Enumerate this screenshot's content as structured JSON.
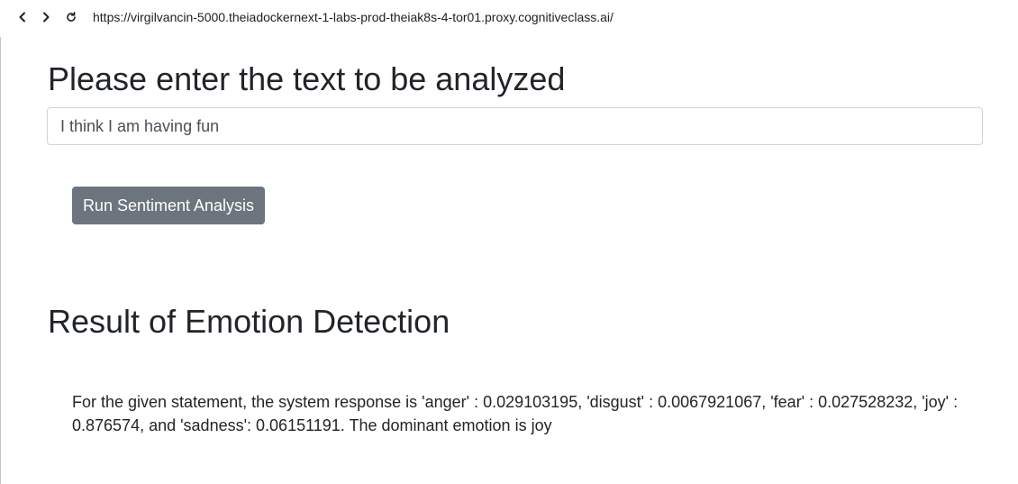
{
  "browser": {
    "back_icon": "chevron-left-icon",
    "forward_icon": "chevron-right-icon",
    "reload_icon": "reload-icon",
    "url": "https://virgilvancin-5000.theiadockernext-1-labs-prod-theiak8s-4-tor01.proxy.cognitiveclass.ai/"
  },
  "page": {
    "heading": "Please enter the text to be analyzed",
    "input_value": "I think I am having fun",
    "button_label": "Run Sentiment Analysis",
    "result_heading": "Result of Emotion Detection",
    "result_text": "For the given statement, the system response is 'anger' : 0.029103195, 'disgust' : 0.0067921067, 'fear' : 0.027528232, 'joy' : 0.876574, and 'sadness': 0.06151191. The dominant emotion is joy"
  },
  "colors": {
    "button_bg": "#6c757d",
    "text": "#212529",
    "input_border": "#ced4da"
  }
}
